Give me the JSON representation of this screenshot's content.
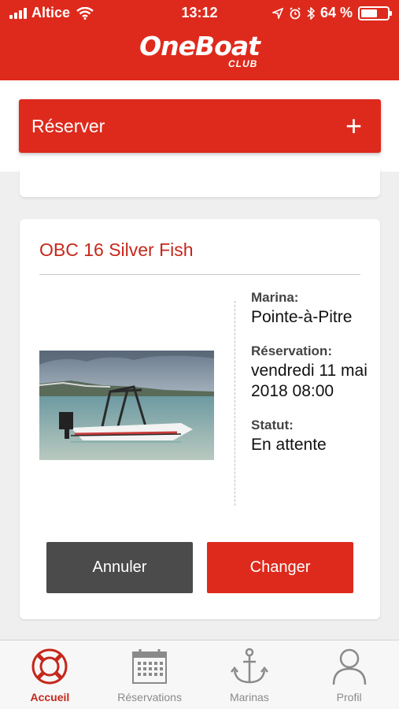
{
  "status_bar": {
    "carrier": "Altice",
    "time": "13:12",
    "battery": "64 %",
    "battery_level": 0.64
  },
  "header": {
    "logo_main": "OneBoat",
    "logo_sub": "CLUB"
  },
  "reserve": {
    "label": "Réserver",
    "icon": "+"
  },
  "booking": {
    "title": "OBC 16 Silver Fish",
    "marina_label": "Marina:",
    "marina_value": "Pointe-à-Pitre",
    "reservation_label": "Réservation:",
    "reservation_value": "vendredi 11 mai 2018 08:00",
    "status_label": "Statut:",
    "status_value": "En attente",
    "cancel_label": "Annuler",
    "change_label": "Changer"
  },
  "tabs": [
    {
      "label": "Accueil",
      "icon": "lifebuoy-icon",
      "active": true
    },
    {
      "label": "Réservations",
      "icon": "calendar-icon",
      "active": false
    },
    {
      "label": "Marinas",
      "icon": "anchor-icon",
      "active": false
    },
    {
      "label": "Profil",
      "icon": "user-icon",
      "active": false
    }
  ],
  "colors": {
    "brand_red": "#de2a1c",
    "title_red": "#c5281c",
    "dark_button": "#4b4b4b",
    "inactive_tab": "#8a8a8a"
  }
}
